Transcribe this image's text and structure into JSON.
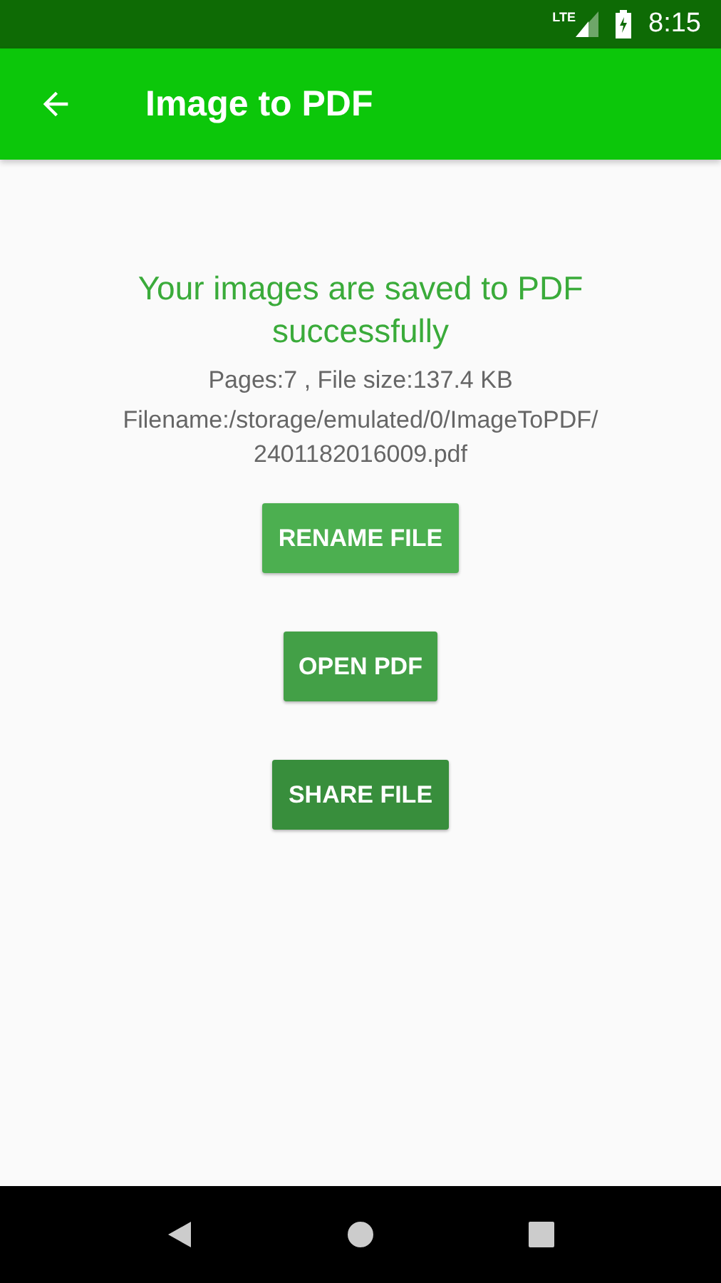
{
  "status_bar": {
    "network": "LTE",
    "time": "8:15"
  },
  "app_bar": {
    "title": "Image to PDF"
  },
  "message": {
    "headline": "Your images are saved to PDF successfully",
    "info": "Pages:7 , File size:137.4 KB",
    "filename": "Filename:/storage/emulated/0/ImageToPDF/ 2401182016009.pdf"
  },
  "buttons": [
    {
      "label": "RENAME FILE",
      "color": "#4caf50"
    },
    {
      "label": "OPEN PDF",
      "color": "#43a047"
    },
    {
      "label": "SHARE FILE",
      "color": "#388e3c"
    }
  ]
}
